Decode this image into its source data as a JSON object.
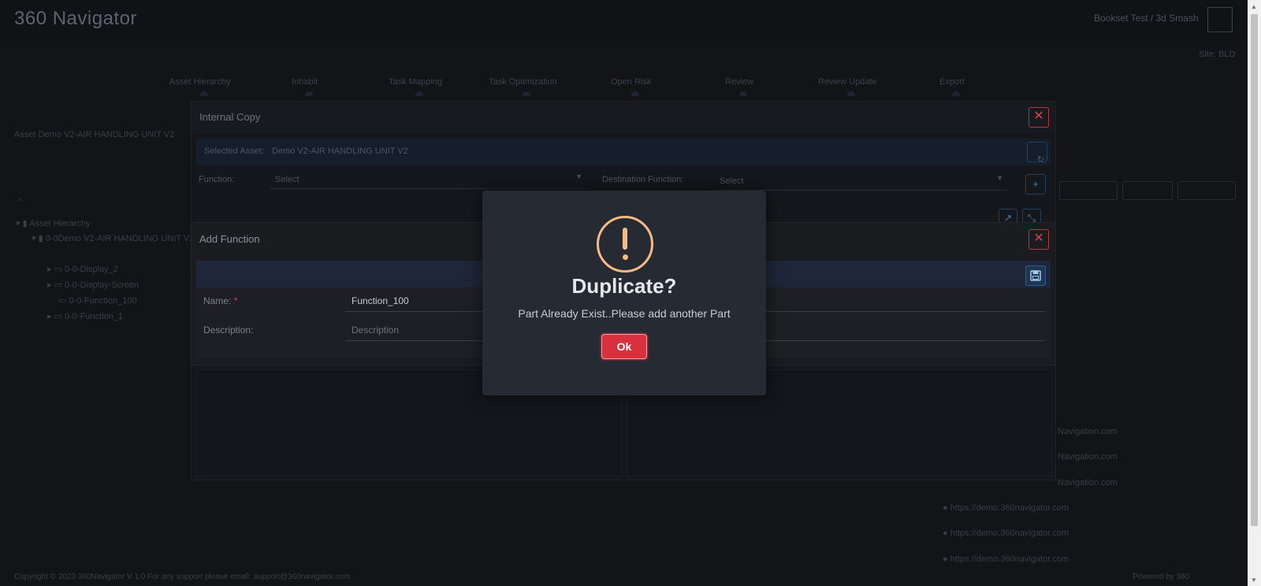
{
  "app": {
    "brand": "360 Navigator",
    "user": "Bookset Test / 3d Smash",
    "sub_label": "Site: BLD",
    "steps": [
      "Asset Hierarchy",
      "Inhabit",
      "Task Mapping",
      "Task Optimization",
      "Open Risk",
      "Review",
      "Review Update",
      "Export"
    ],
    "breadcrumb": "Asset Demo V2-AIR HANDLING UNIT V2",
    "tree": {
      "root": "Asset Hierarchy",
      "node": "0-0Demo V2-AIR HANDLING UNIT V2",
      "children": [
        "0-0-Display_2",
        "0-0-Display-Screen",
        "0-0-Function_100",
        "0-0-Function_1"
      ]
    },
    "right_list": [
      "Navigation.com",
      "Navigation.com",
      "Navigation.com",
      "https://demo.360navigator.com",
      "https://demo.360navigator.com",
      "https://demo.360navigator.com"
    ],
    "footer": "Copyright © 2023 360Navigator V 1.0    For any support please email: support@360navigator.com",
    "footer_right": "Powered by 360"
  },
  "internal_copy": {
    "title": "Internal Copy",
    "selected_asset_label": "Selected Asset:",
    "selected_asset_value": "Demo V2-AIR HANDLING UNIT V2",
    "function_label": "Function:",
    "function_value": "Select",
    "destination_label": "Destination Function:",
    "destination_value": "Select"
  },
  "add_function": {
    "title": "Add Function",
    "name_label": "Name:",
    "required_mark": "*",
    "name_value": "Function_100",
    "description_label": "Description:",
    "description_placeholder": "Description"
  },
  "dialog": {
    "title": "Duplicate?",
    "message": "Part Already Exist..Please add another Part",
    "ok_label": "Ok",
    "icon": "exclamation-icon",
    "icon_color": "#f8bb86",
    "button_color": "#d9303e"
  }
}
